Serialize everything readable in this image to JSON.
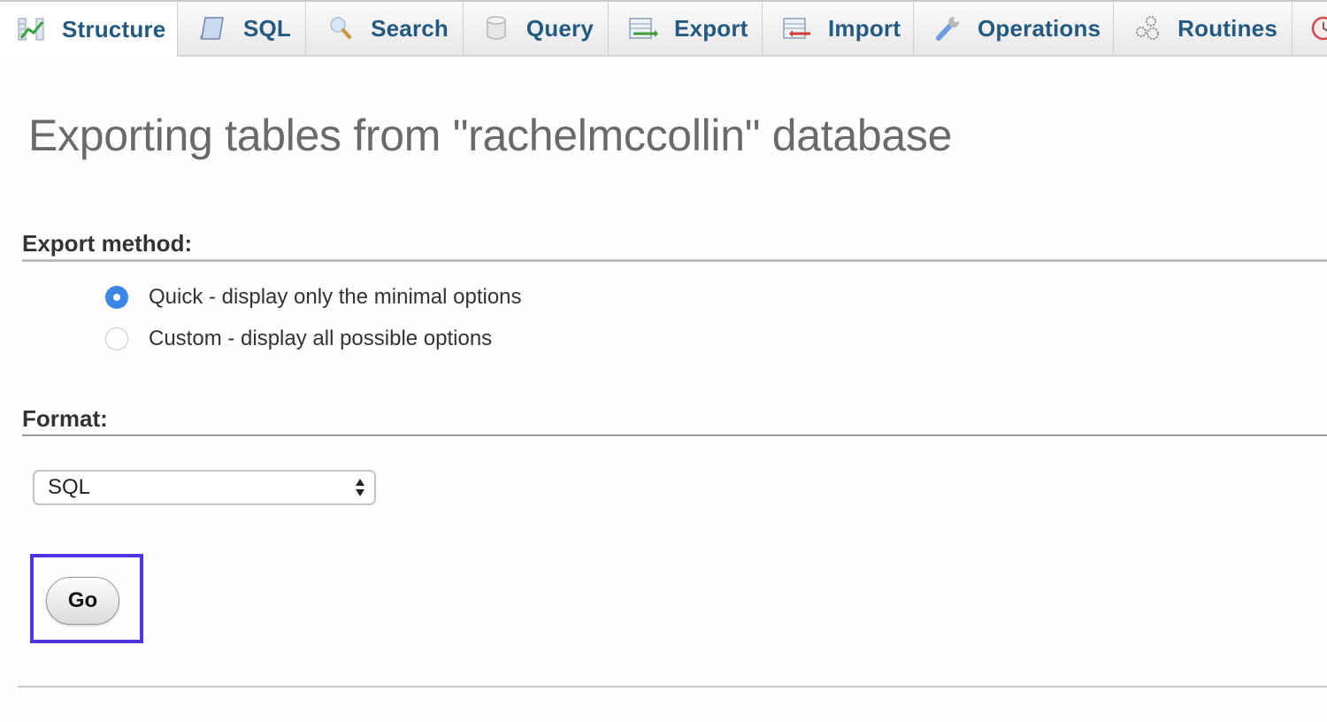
{
  "tabs": [
    {
      "label": "Structure",
      "icon": "structure-icon",
      "active": true
    },
    {
      "label": "SQL",
      "icon": "sql-scroll-icon",
      "active": false
    },
    {
      "label": "Search",
      "icon": "search-magnifier-icon",
      "active": false
    },
    {
      "label": "Query",
      "icon": "query-database-icon",
      "active": false
    },
    {
      "label": "Export",
      "icon": "export-table-icon",
      "active": false
    },
    {
      "label": "Import",
      "icon": "import-table-icon",
      "active": false
    },
    {
      "label": "Operations",
      "icon": "wrench-icon",
      "active": false
    },
    {
      "label": "Routines",
      "icon": "gears-icon",
      "active": false
    },
    {
      "label": "",
      "icon": "events-clock-icon",
      "active": false
    }
  ],
  "page": {
    "title": "Exporting tables from \"rachelmccollin\" database"
  },
  "export_method": {
    "heading": "Export method:",
    "options": [
      {
        "label": "Quick - display only the minimal options",
        "checked": true
      },
      {
        "label": "Custom - display all possible options",
        "checked": false
      }
    ]
  },
  "format": {
    "heading": "Format:",
    "selected": "SQL"
  },
  "actions": {
    "go_label": "Go",
    "highlight_color": "#4f35e0"
  },
  "colors": {
    "tab_text": "#235a81",
    "radio_checked": "#3b85e5",
    "title_text": "#6a6a6a"
  }
}
